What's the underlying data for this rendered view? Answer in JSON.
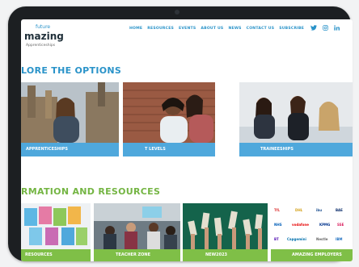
{
  "header": {
    "logo_top": "future",
    "logo_main": "mazing",
    "logo_sub": "Apprenticeships",
    "nav": [
      "HOME",
      "RESOURCES",
      "EVENTS",
      "ABOUT US",
      "NEWS",
      "CONTACT US",
      "SUBSCRIBE"
    ],
    "socials": [
      "twitter-icon",
      "instagram-icon",
      "linkedin-icon"
    ]
  },
  "options": {
    "title": "LORE THE OPTIONS",
    "cards": [
      {
        "label": "APPRENTICESHIPS"
      },
      {
        "label": "T LEVELS"
      },
      {
        "label": "TRAINEESHIPS"
      }
    ]
  },
  "resources": {
    "title": "RMATION AND RESOURCES",
    "cards": [
      {
        "label": "RESOURCES"
      },
      {
        "label": "TEACHER ZONE"
      },
      {
        "label": "NEW2023"
      },
      {
        "label": "AMAZING EMPLOYERS"
      }
    ],
    "employer_logos": [
      "TfL",
      "DHL",
      "ibu",
      "BAE",
      "NHS",
      "vodafone",
      "KPMG",
      "SSE",
      "BT",
      "Capgemini",
      "Nestle",
      "IBM"
    ]
  },
  "colors": {
    "accent_blue": "#2a93c9",
    "accent_green": "#74b543",
    "device": "#1c1f22"
  }
}
